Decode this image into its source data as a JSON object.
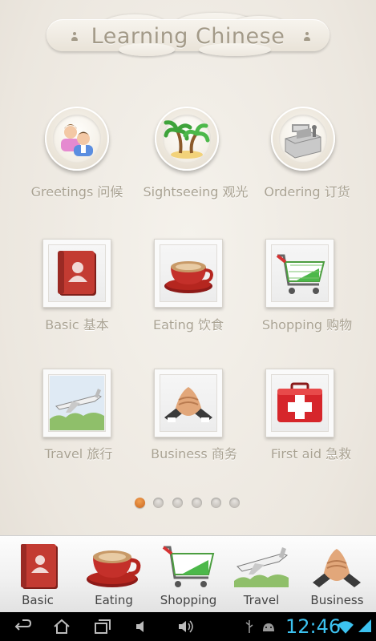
{
  "app": {
    "title": "Learning Chinese"
  },
  "categories_top": [
    {
      "label": "Greetings 问候",
      "icon": "greetings-people-icon"
    },
    {
      "label": "Sightseeing 观光",
      "icon": "palm-trees-icon"
    },
    {
      "label": "Ordering 订货",
      "icon": "cash-register-icon"
    }
  ],
  "categories_mid": [
    {
      "label": "Basic 基本",
      "icon": "address-book-icon"
    },
    {
      "label": "Eating 饮食",
      "icon": "coffee-cup-icon"
    },
    {
      "label": "Shopping 购物",
      "icon": "shopping-cart-icon"
    }
  ],
  "categories_bottom": [
    {
      "label": "Travel 旅行",
      "icon": "airplane-icon"
    },
    {
      "label": "Business 商务",
      "icon": "handshake-icon"
    },
    {
      "label": "First aid 急救",
      "icon": "first-aid-kit-icon"
    }
  ],
  "pager": {
    "count": 6,
    "active_index": 0
  },
  "dock": [
    {
      "label": "Basic",
      "icon": "address-book-icon"
    },
    {
      "label": "Eating",
      "icon": "coffee-cup-icon"
    },
    {
      "label": "Shopping",
      "icon": "shopping-cart-icon"
    },
    {
      "label": "Travel",
      "icon": "airplane-icon"
    },
    {
      "label": "Business",
      "icon": "handshake-icon"
    }
  ],
  "status_bar": {
    "time": "12:46",
    "clock_color": "#3cc2f0"
  },
  "colors": {
    "accent_orange": "#d9782b",
    "label_gray": "#a9a292",
    "book_red": "#b8322a",
    "kit_red": "#d6262b",
    "cart_green": "#4cb84a"
  }
}
